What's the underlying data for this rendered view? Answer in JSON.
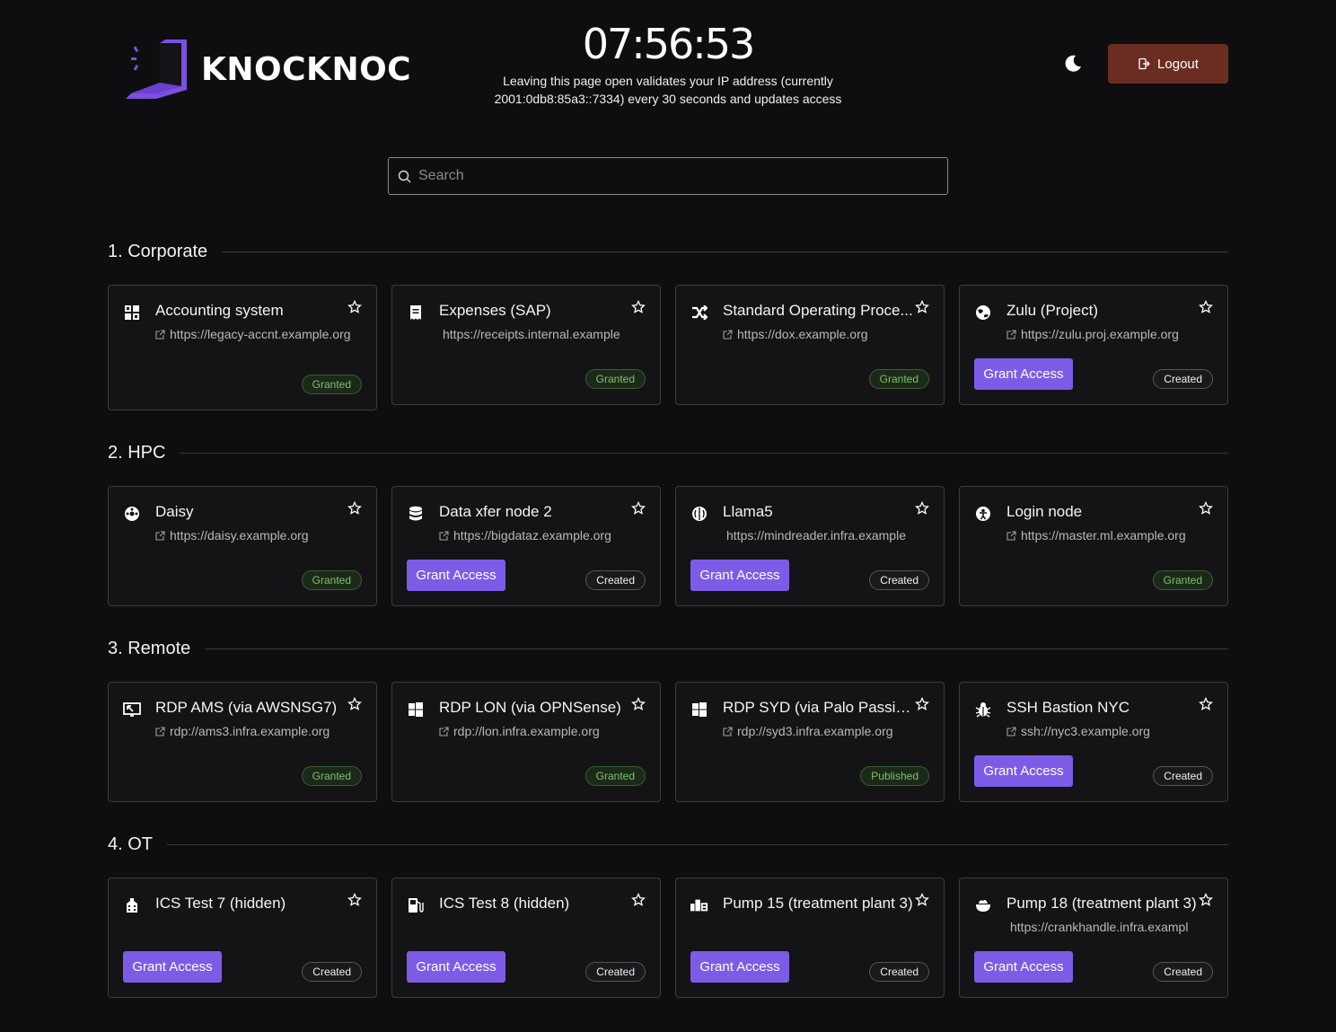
{
  "header": {
    "brand": "KNOCKNOC",
    "clock": "07:56:53",
    "notice": "Leaving this page open validates your IP address (currently 2001:0db8:85a3::7334) every 30 seconds and updates access",
    "logout_label": "Logout"
  },
  "search": {
    "placeholder": "Search"
  },
  "sections": [
    {
      "title": "1. Corporate",
      "cards": [
        {
          "name": "Accounting system",
          "icon": "grid-icon",
          "url": "https://legacy-accnt.example.org",
          "status": "Granted",
          "grant_label": ""
        },
        {
          "name": "Expenses (SAP)",
          "icon": "receipt-icon",
          "url": "https://receipts.internal.example",
          "status": "Granted",
          "grant_label": ""
        },
        {
          "name": "Standard Operating Proce...",
          "icon": "shuffle-icon",
          "url": "https://dox.example.org",
          "status": "Granted",
          "grant_label": ""
        },
        {
          "name": "Zulu (Project)",
          "icon": "earth-icon",
          "url": "https://zulu.proj.example.org",
          "status": "Created",
          "grant_label": "Grant Access"
        }
      ]
    },
    {
      "title": "2. HPC",
      "cards": [
        {
          "name": "Daisy",
          "icon": "flower-icon",
          "url": "https://daisy.example.org",
          "status": "Granted",
          "grant_label": ""
        },
        {
          "name": "Data xfer node 2",
          "icon": "database-icon",
          "url": "https://bigdataz.example.org",
          "status": "Created",
          "grant_label": "Grant Access"
        },
        {
          "name": "Llama5",
          "icon": "brain-icon",
          "url": "https://mindreader.infra.example",
          "status": "Created",
          "grant_label": "Grant Access"
        },
        {
          "name": "Login node",
          "icon": "person-circle-icon",
          "url": "https://master.ml.example.org",
          "status": "Granted",
          "grant_label": ""
        }
      ]
    },
    {
      "title": "3. Remote",
      "cards": [
        {
          "name": "RDP AMS (via AWSNSG7)",
          "icon": "remote-desktop-icon",
          "url": "rdp://ams3.infra.example.org",
          "status": "Granted",
          "grant_label": ""
        },
        {
          "name": "RDP LON (via OPNSense)",
          "icon": "windows-icon",
          "url": "rdp://lon.infra.example.org",
          "status": "Granted",
          "grant_label": ""
        },
        {
          "name": "RDP SYD (via Palo Passive+)",
          "icon": "windows-icon",
          "url": "rdp://syd3.infra.example.org",
          "status": "Published",
          "grant_label": ""
        },
        {
          "name": "SSH Bastion NYC",
          "icon": "bug-icon",
          "url": "ssh://nyc3.example.org",
          "status": "Created",
          "grant_label": "Grant Access"
        }
      ]
    },
    {
      "title": "4. OT",
      "cards": [
        {
          "name": "ICS Test 7 (hidden)",
          "icon": "factory-icon",
          "url": "",
          "status": "Created",
          "grant_label": "Grant Access"
        },
        {
          "name": "ICS Test 8 (hidden)",
          "icon": "fuel-pump-icon",
          "url": "",
          "status": "Created",
          "grant_label": "Grant Access"
        },
        {
          "name": "Pump 15 (treatment plant 3)",
          "icon": "pump-icon",
          "url": "",
          "status": "Created",
          "grant_label": "Grant Access"
        },
        {
          "name": "Pump 18 (treatment plant 3)",
          "icon": "bowl-icon",
          "url": "https://crankhandle.infra.exampl",
          "status": "Created",
          "grant_label": "Grant Access"
        }
      ]
    }
  ]
}
